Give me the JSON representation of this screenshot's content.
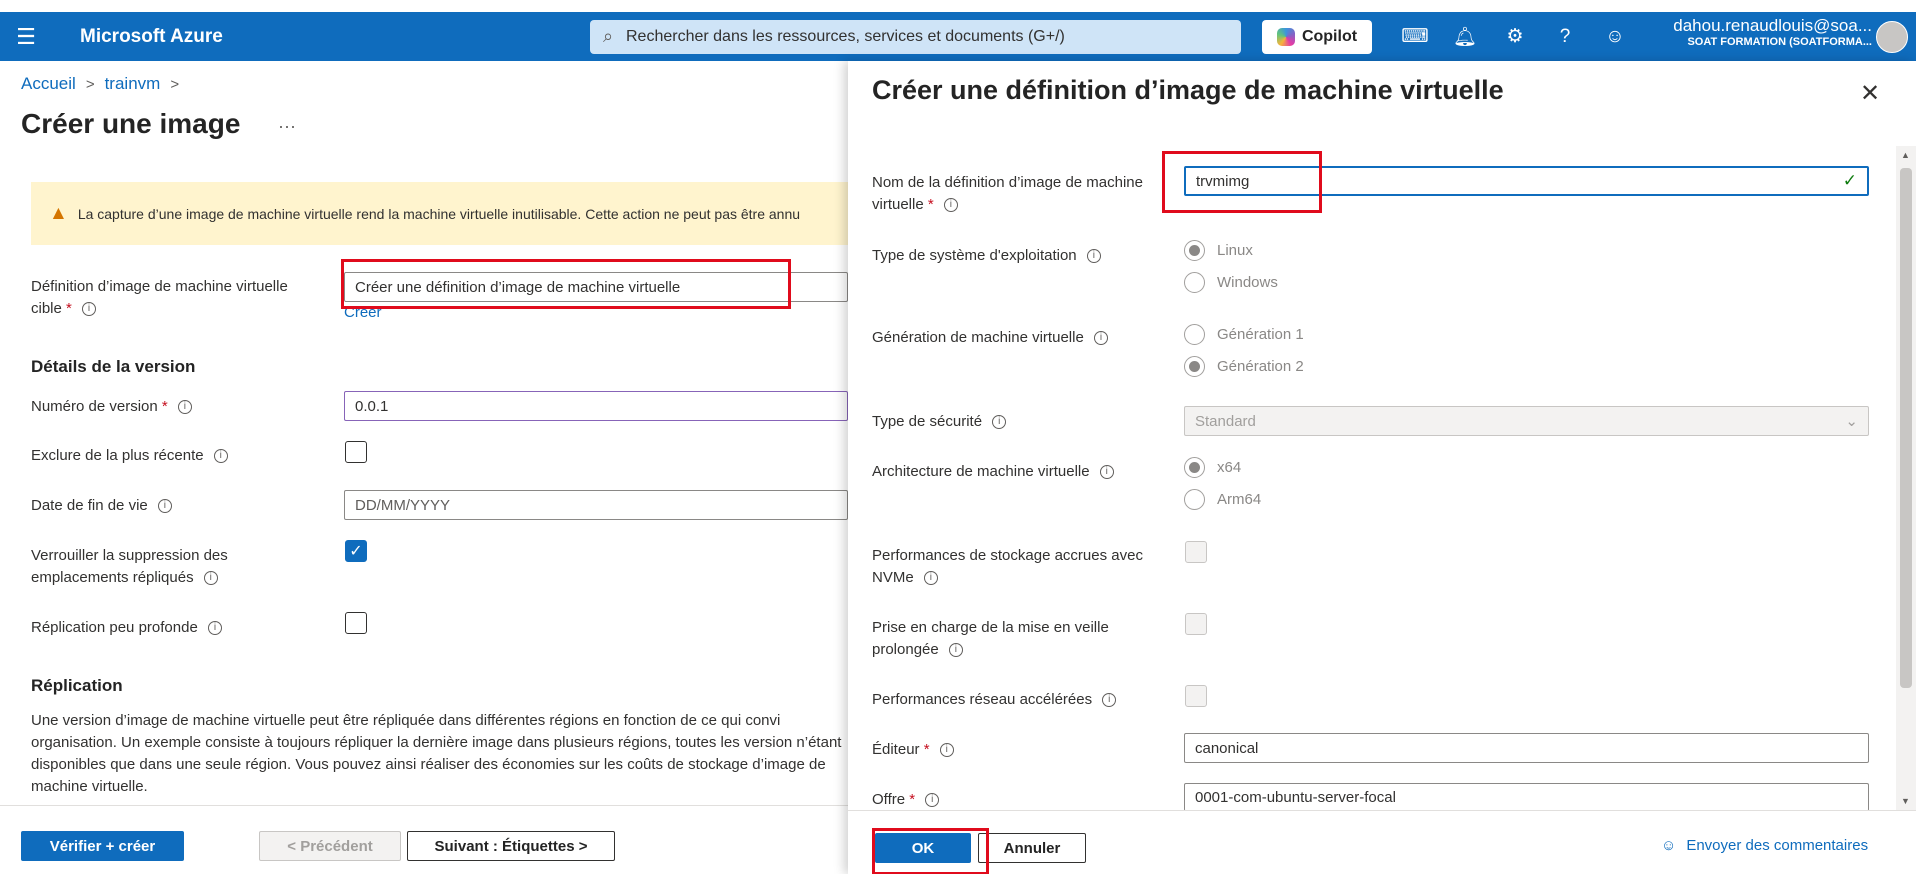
{
  "topbar": {
    "brand": "Microsoft Azure",
    "search_placeholder": "Rechercher dans les ressources, services et documents (G+/)",
    "copilot_label": "Copilot",
    "user_name": "dahou.renaudlouis@soa...",
    "user_org": "SOAT FORMATION (SOATFORMA..."
  },
  "breadcrumb": {
    "home": "Accueil",
    "sep": ">",
    "item": "trainvm",
    "sep2": ">"
  },
  "page": {
    "title": "Créer une image",
    "more": "···",
    "warning": "La capture d’une image de machine virtuelle rend la machine virtuelle inutilisable. Cette action ne peut pas être annu",
    "target_def_label_1": "Définition d’image de machine virtuelle",
    "target_def_label_2": "cible",
    "target_def_value": "Créer une définition d’image de machine virtuelle",
    "create_link": "Créer",
    "version_section": "Détails de la version",
    "version_label": "Numéro de version",
    "version_value": "0.0.1",
    "exclude_label": "Exclure de la plus récente",
    "eol_label": "Date de fin de vie",
    "eol_placeholder": "DD/MM/YYYY",
    "lock_label_1": "Verrouiller la suppression des",
    "lock_label_2": "emplacements répliqués",
    "shallow_label": "Réplication peu profonde",
    "replication_section": "Réplication",
    "replication_text": "Une version d’image de machine virtuelle peut être répliquée dans différentes régions en fonction de ce qui convi organisation. Un exemple consiste à toujours répliquer la dernière image dans plusieurs régions, toutes les version n’étant disponibles que dans une seule région. Vous pouvez ainsi réaliser des économies sur les coûts de stockage d’image de machine virtuelle.",
    "btn_review": "Vérifier + créer",
    "btn_prev": "< Précédent",
    "btn_next": "Suivant : Étiquettes >"
  },
  "panel": {
    "title": "Créer une définition d’image de machine virtuelle",
    "close": "✕",
    "name_label_1": "Nom de la définition d’image de machine",
    "name_label_2": "virtuelle",
    "name_value": "trvmimg",
    "os_label": "Type de système d'exploitation",
    "os_options": [
      "Linux",
      "Windows"
    ],
    "gen_label": "Génération de machine virtuelle",
    "gen_options": [
      "Génération 1",
      "Génération 2"
    ],
    "security_label": "Type de sécurité",
    "security_value": "Standard",
    "arch_label": "Architecture de machine virtuelle",
    "arch_options": [
      "x64",
      "Arm64"
    ],
    "nvme_label_1": "Performances de stockage accrues avec",
    "nvme_label_2": "NVMe",
    "hibernate_label_1": "Prise en charge de la mise en veille",
    "hibernate_label_2": "prolongée",
    "accel_label": "Performances réseau accélérées",
    "publisher_label": "Éditeur",
    "publisher_value": "canonical",
    "offer_label": "Offre",
    "offer_value": "0001-com-ubuntu-server-focal",
    "btn_ok": "OK",
    "btn_cancel": "Annuler",
    "feedback": "Envoyer des commentaires"
  },
  "colors": {
    "accent": "#0f6cbd",
    "highlight": "#e00b1c",
    "warning_bg": "#fff4ce"
  }
}
